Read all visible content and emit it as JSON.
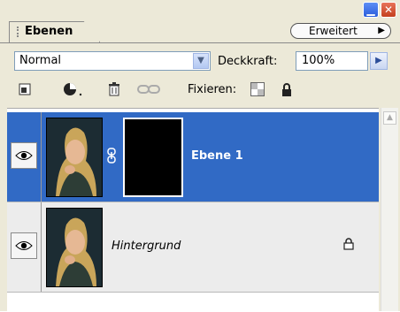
{
  "tab": {
    "label": "Ebenen"
  },
  "menu": {
    "label": "Erweitert"
  },
  "blend_mode": {
    "value": "Normal"
  },
  "opacity": {
    "label": "Deckkraft:",
    "value": "100%"
  },
  "lock": {
    "label": "Fixieren:"
  },
  "layers": [
    {
      "name": "Ebene 1",
      "selected": true,
      "has_mask": true
    },
    {
      "name": "Hintergrund",
      "selected": false,
      "locked": true
    }
  ],
  "colors": {
    "selection": "#316ac5",
    "panel": "#ece9d8"
  }
}
